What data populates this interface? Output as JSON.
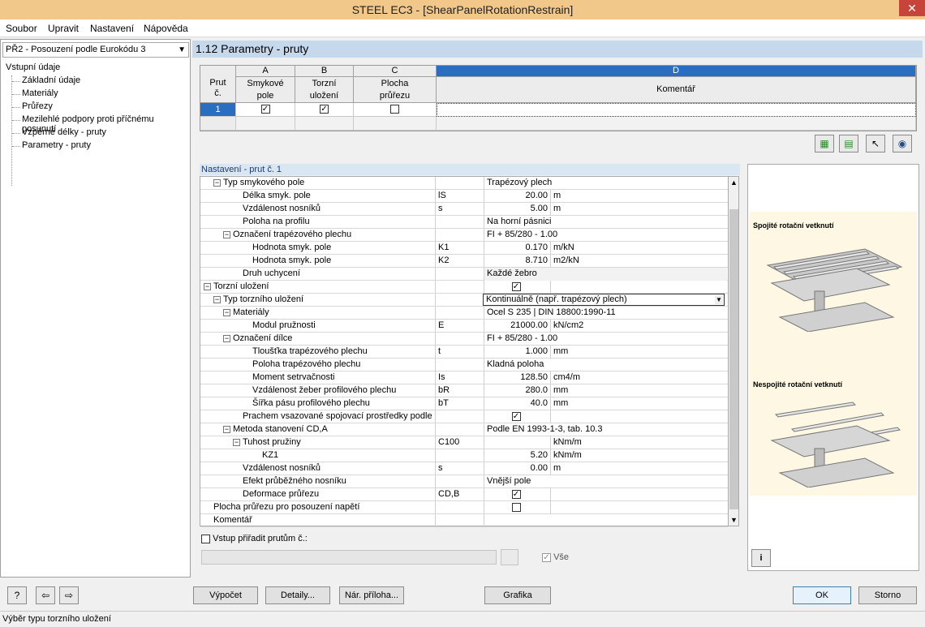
{
  "window": {
    "title": "STEEL EC3 - [ShearPanelRotationRestrain]",
    "close": "✕"
  },
  "menu": [
    "Soubor",
    "Upravit",
    "Nastavení",
    "Nápověda"
  ],
  "nav": {
    "module": "PŘ2 - Posouzení podle Eurokódu 3",
    "root": "Vstupní údaje",
    "items": [
      "Základní údaje",
      "Materiály",
      "Průřezy",
      "Mezilehlé podpory proti příčnému posunutí",
      "Vzpěrné délky - pruty",
      "Parametry - pruty"
    ]
  },
  "panel": {
    "title": "1.12 Parametry - pruty"
  },
  "table": {
    "col_letters": [
      "A",
      "B",
      "C",
      "D"
    ],
    "member_header": [
      "Prut",
      "č."
    ],
    "col_a": [
      "Smykové",
      "pole"
    ],
    "col_b": [
      "Torzní",
      "uložení"
    ],
    "col_c": [
      "Plocha",
      "průřezu"
    ],
    "col_d": "Komentář",
    "row_num": "1"
  },
  "settings": {
    "title": "Nastavení - prut č. 1",
    "rows": [
      {
        "label": "Typ smykového pole",
        "sym": "",
        "val": "Trapézový plech",
        "unit": ""
      },
      {
        "label": "Délka smyk. pole",
        "sym": "lS",
        "val": "20.00",
        "unit": "m"
      },
      {
        "label": "Vzdálenost nosníků",
        "sym": "s",
        "val": "5.00",
        "unit": "m"
      },
      {
        "label": "Poloha na profilu",
        "sym": "",
        "val": "Na horní pásnici",
        "unit": ""
      },
      {
        "label": "Označení trapézového plechu",
        "sym": "",
        "val": "FI + 85/280 - 1.00",
        "unit": ""
      },
      {
        "label": "Hodnota smyk. pole",
        "sym": "K1",
        "val": "0.170",
        "unit": "m/kN"
      },
      {
        "label": "Hodnota smyk. pole",
        "sym": "K2",
        "val": "8.710",
        "unit": "m2/kN"
      },
      {
        "label": "Druh uchycení",
        "sym": "",
        "val": "Každé žebro",
        "unit": ""
      },
      {
        "label": "Torzní uložení",
        "sym": "",
        "val": "",
        "unit": ""
      },
      {
        "label": "Typ torzního uložení",
        "sym": "",
        "val": "Kontinuálně (např. trapézový plech)",
        "unit": ""
      },
      {
        "label": "Materiály",
        "sym": "",
        "val": "Ocel S 235 | DIN 18800:1990-11",
        "unit": ""
      },
      {
        "label": "Modul pružnosti",
        "sym": "E",
        "val": "21000.00",
        "unit": "kN/cm2"
      },
      {
        "label": "Označení dílce",
        "sym": "",
        "val": "FI + 85/280 - 1.00",
        "unit": ""
      },
      {
        "label": "Tloušťka trapézového plechu",
        "sym": "t",
        "val": "1.000",
        "unit": "mm"
      },
      {
        "label": "Poloha trapézového plechu",
        "sym": "",
        "val": "Kladná poloha",
        "unit": ""
      },
      {
        "label": "Moment setrvačnosti",
        "sym": "Is",
        "val": "128.50",
        "unit": "cm4/m"
      },
      {
        "label": "Vzdálenost žeber profilového plechu",
        "sym": "bR",
        "val": "280.0",
        "unit": "mm"
      },
      {
        "label": "Šířka pásu profilového plechu",
        "sym": "bT",
        "val": "40.0",
        "unit": "mm"
      },
      {
        "label": "Prachem vsazované spojovací prostředky podle DI",
        "sym": "",
        "val": "",
        "unit": ""
      },
      {
        "label": "Metoda stanovení CD,A",
        "sym": "",
        "val": "Podle EN 1993-1-3, tab. 10.3",
        "unit": ""
      },
      {
        "label": "Tuhost pružiny",
        "sym": "C100",
        "val": "",
        "unit": "kNm/m"
      },
      {
        "label": "KZ1",
        "sym": "",
        "val": "5.20",
        "unit": "kNm/m"
      },
      {
        "label": "Vzdálenost nosníků",
        "sym": "s",
        "val": "0.00",
        "unit": "m"
      },
      {
        "label": "Efekt průběžného nosníku",
        "sym": "",
        "val": "Vnější pole",
        "unit": ""
      },
      {
        "label": "Deformace průřezu",
        "sym": "CD,B",
        "val": "",
        "unit": ""
      },
      {
        "label": "Plocha průřezu pro posouzení napětí",
        "sym": "",
        "val": "",
        "unit": ""
      },
      {
        "label": "Komentář",
        "sym": "",
        "val": "",
        "unit": ""
      }
    ]
  },
  "preview": {
    "title_continuous": "Spojité rotační vetknutí",
    "title_discontinuous": "Nespojité rotační vetknutí"
  },
  "footer": {
    "assign_label": "Vstup přiřadit prutům č.:",
    "all_label": "Vše"
  },
  "buttons": {
    "calc": "Výpočet",
    "details": "Detaily...",
    "annex": "Nár. příloha...",
    "graphics": "Grafika",
    "ok": "OK",
    "cancel": "Storno"
  },
  "status": "Výběr typu torzního uložení",
  "colors": {
    "title_bar": "#f1c78a",
    "panel_header": "#c6d9ec",
    "selected_column": "#2a6ec2"
  }
}
